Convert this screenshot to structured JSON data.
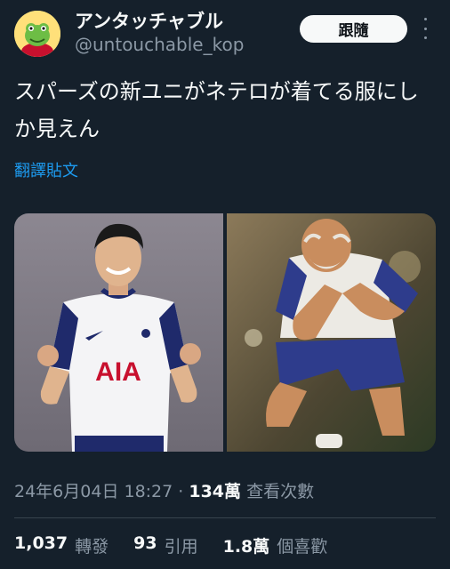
{
  "author": {
    "display_name": "アンタッチャブル",
    "handle": "@untouchable_kop"
  },
  "follow_label": "跟隨",
  "tweet": {
    "text": "スパーズの新ユニがネテロが着てる服にしか見えん",
    "translate_label": "翻譯貼文"
  },
  "media": {
    "left_shirt_text": "AIA"
  },
  "meta": {
    "time": "24年6月04日 18:27 · ",
    "views": "134萬",
    "views_label": " 查看次數"
  },
  "stats": {
    "reposts": "1,037",
    "reposts_label": "轉發",
    "quotes": "93",
    "quotes_label": "引用",
    "likes": "1.8萬",
    "likes_label": "個喜歡"
  },
  "colors": {
    "background": "#15202b",
    "text": "#f7f9f9",
    "secondary": "#8b98a5",
    "link": "#1d9bf0"
  }
}
